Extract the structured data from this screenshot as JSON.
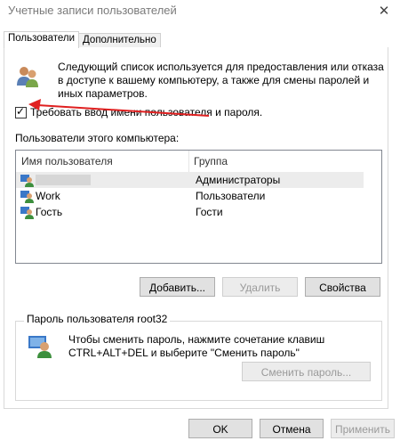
{
  "window": {
    "title": "Учетные записи пользователей",
    "close_glyph": "✕"
  },
  "tabs": [
    {
      "label": "Пользователи",
      "active": true
    },
    {
      "label": "Дополнительно",
      "active": false
    }
  ],
  "description": "Следующий список используется для предоставления или отказа в доступе к вашему компьютеру, а также для смены паролей и иных параметров.",
  "require_login": {
    "label": "Требовать ввод имени пользователя и пароля.",
    "checked": true
  },
  "users_section_label": "Пользователи этого компьютера:",
  "users_table": {
    "columns": [
      "Имя пользователя",
      "Группа"
    ],
    "rows": [
      {
        "name": "",
        "group": "Администраторы",
        "selected": true
      },
      {
        "name": "Work",
        "group": "Пользователи",
        "selected": false
      },
      {
        "name": "Гость",
        "group": "Гости",
        "selected": false
      }
    ]
  },
  "user_buttons": {
    "add": "Добавить...",
    "remove": "Удалить",
    "properties": "Свойства"
  },
  "password_group": {
    "label": "Пароль пользователя root32",
    "text": "Чтобы сменить пароль, нажмите сочетание клавиш CTRL+ALT+DEL и выберите \"Сменить пароль\"",
    "button": "Сменить пароль..."
  },
  "footer": {
    "ok": "OK",
    "cancel": "Отмена",
    "apply": "Применить"
  },
  "colors": {
    "annotation_arrow": "#e02020",
    "button_face": "#e1e1e1",
    "selection": "#ececec"
  },
  "icons": [
    "users-icon",
    "user-icon",
    "password-user-icon",
    "checkmark-icon",
    "close-icon"
  ]
}
